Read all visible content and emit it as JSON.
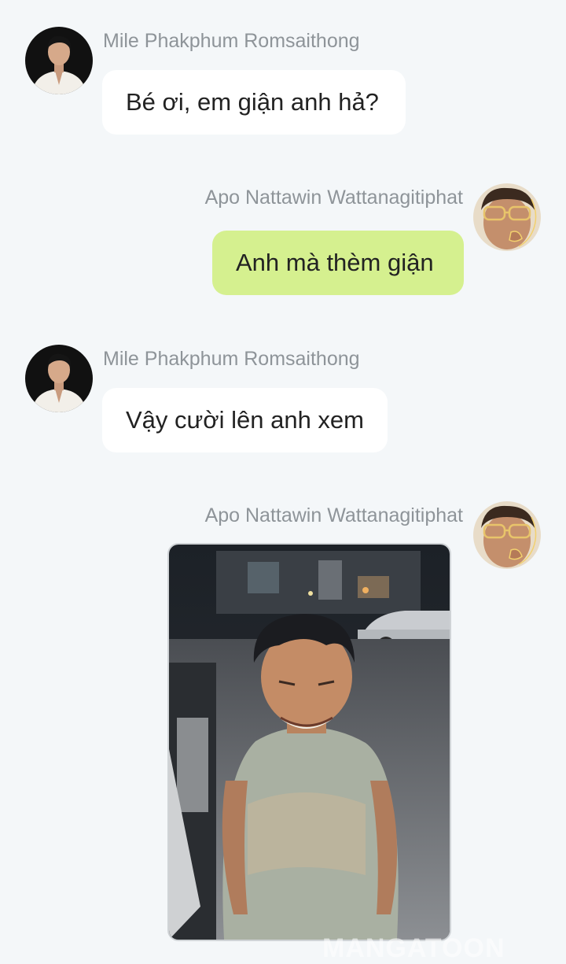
{
  "messages": [
    {
      "sender": "Mile Phakphum Romsaithong",
      "text": "Bé ơi, em giận anh hả?",
      "side": "left"
    },
    {
      "sender": "Apo Nattawin Wattanagitiphat",
      "text": "Anh mà thèm giận",
      "side": "right"
    },
    {
      "sender": "Mile Phakphum Romsaithong",
      "text": "Vậy cười lên anh xem",
      "side": "left"
    },
    {
      "sender": "Apo Nattawin Wattanagitiphat",
      "type": "photo",
      "side": "right"
    }
  ],
  "watermark": "MANGATOON",
  "colors": {
    "background": "#f4f7f9",
    "incoming_bubble": "#ffffff",
    "outgoing_bubble": "#d5f08f",
    "sender_name": "#8e9499"
  }
}
